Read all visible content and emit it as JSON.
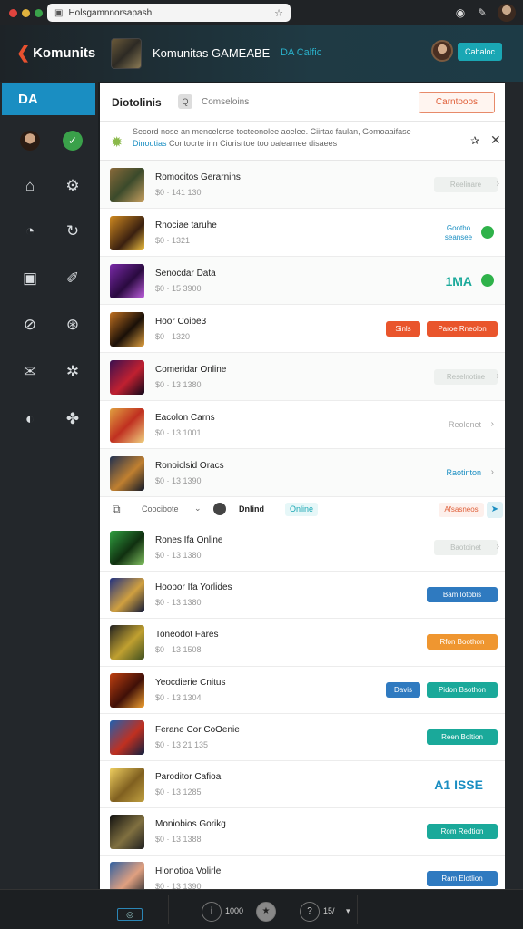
{
  "browser": {
    "url": "Holsgamnnorsapash",
    "dot_colors": [
      "#e0443e",
      "#e0b23e",
      "#3aa34a"
    ]
  },
  "header": {
    "brand": "Komunits",
    "title": "Komunitas GAMEABE",
    "subtitle": "DA Calfic",
    "button": "Cabaloc"
  },
  "sidebar": {
    "active_label": "DA"
  },
  "topbar": {
    "title": "Diotolinis",
    "chip": "Q",
    "tab": "Comseloins",
    "button": "Carntooos"
  },
  "notice": {
    "line1": "Secord nose an mencelorse tocteonolee aoelee. Ciirtac faulan, Gomoaaifase",
    "line2_highlight": "Dinoutias",
    "line2_rest": "Contocrte inn Ciorisrtoe too oaleamee disaees"
  },
  "rows_top": [
    {
      "name": "Romocitos Gerarnins",
      "meta": "$0 · 141 130",
      "actions": [
        {
          "label": "Reelinare",
          "style": "ghost"
        }
      ]
    },
    {
      "name": "Rnociae taruhe",
      "meta": "$0 · 1321",
      "actions": [
        {
          "label": "Gootho seansee",
          "style": "link"
        }
      ]
    },
    {
      "name": "Senocdar Data",
      "meta": "$0 · 15 3900",
      "actions": [
        {
          "label": "1MA",
          "style": "big"
        }
      ]
    },
    {
      "name": "Hoor Coibe3",
      "meta": "$0 · 1320",
      "actions": [
        {
          "label": "Sinls",
          "style": "red"
        },
        {
          "label": "Paroe Rneolon",
          "style": "red"
        }
      ]
    },
    {
      "name": "Comeridar Online",
      "meta": "$0 · 13 1380",
      "actions": [
        {
          "label": "Reselnotine",
          "style": "ghost"
        }
      ]
    },
    {
      "name": "Eacolon Carns",
      "meta": "$0 · 13 1001",
      "actions": [
        {
          "label": "Reolenet",
          "style": "text"
        }
      ]
    },
    {
      "name": "Ronoiclsid Oracs",
      "meta": "$0 · 13 1390",
      "actions": [
        {
          "label": "Raotinton",
          "style": "textblue"
        }
      ]
    }
  ],
  "filter": {
    "label": "Coocibote",
    "status_a": "Dnlind",
    "status_b": "Online",
    "button": "Afsasneos"
  },
  "rows_bottom": [
    {
      "name": "Rones Ifa Online",
      "meta": "$0 · 13 1380",
      "actions": [
        {
          "label": "Baotoinet",
          "style": "ghost"
        }
      ]
    },
    {
      "name": "Hoopor Ifa Yorlides",
      "meta": "$0 · 13 1380",
      "actions": [
        {
          "label": "Bam Iotobis",
          "style": "blue"
        }
      ]
    },
    {
      "name": "Toneodot Fares",
      "meta": "$0 · 13 1508",
      "actions": [
        {
          "label": "Rfon Boothon",
          "style": "orange"
        }
      ]
    },
    {
      "name": "Yeocdierie Cnitus",
      "meta": "$0 · 13 1304",
      "actions": [
        {
          "label": "Davis",
          "style": "blue"
        },
        {
          "label": "Pidon Bsothon",
          "style": "teal"
        }
      ]
    },
    {
      "name": "Ferane Cor CoOenie",
      "meta": "$0 · 13 21 135",
      "actions": [
        {
          "label": "Reen Boltion",
          "style": "teal"
        }
      ]
    },
    {
      "name": "Paroditor Cafioa",
      "meta": "$0 · 13 1285",
      "actions": [
        {
          "label": "A1 ISSE",
          "style": "bigblue"
        }
      ]
    },
    {
      "name": "Moniobios Gorikg",
      "meta": "$0 · 13 1388",
      "actions": [
        {
          "label": "Rom Redtion",
          "style": "teal"
        }
      ]
    },
    {
      "name": "Hlonotioa Volirle",
      "meta": "$0 · 13 1390",
      "actions": [
        {
          "label": "Ram Elotlion",
          "style": "blue"
        }
      ]
    }
  ],
  "bottombar": {
    "left": "◎",
    "mid1": "1000",
    "mid2": "15/"
  }
}
